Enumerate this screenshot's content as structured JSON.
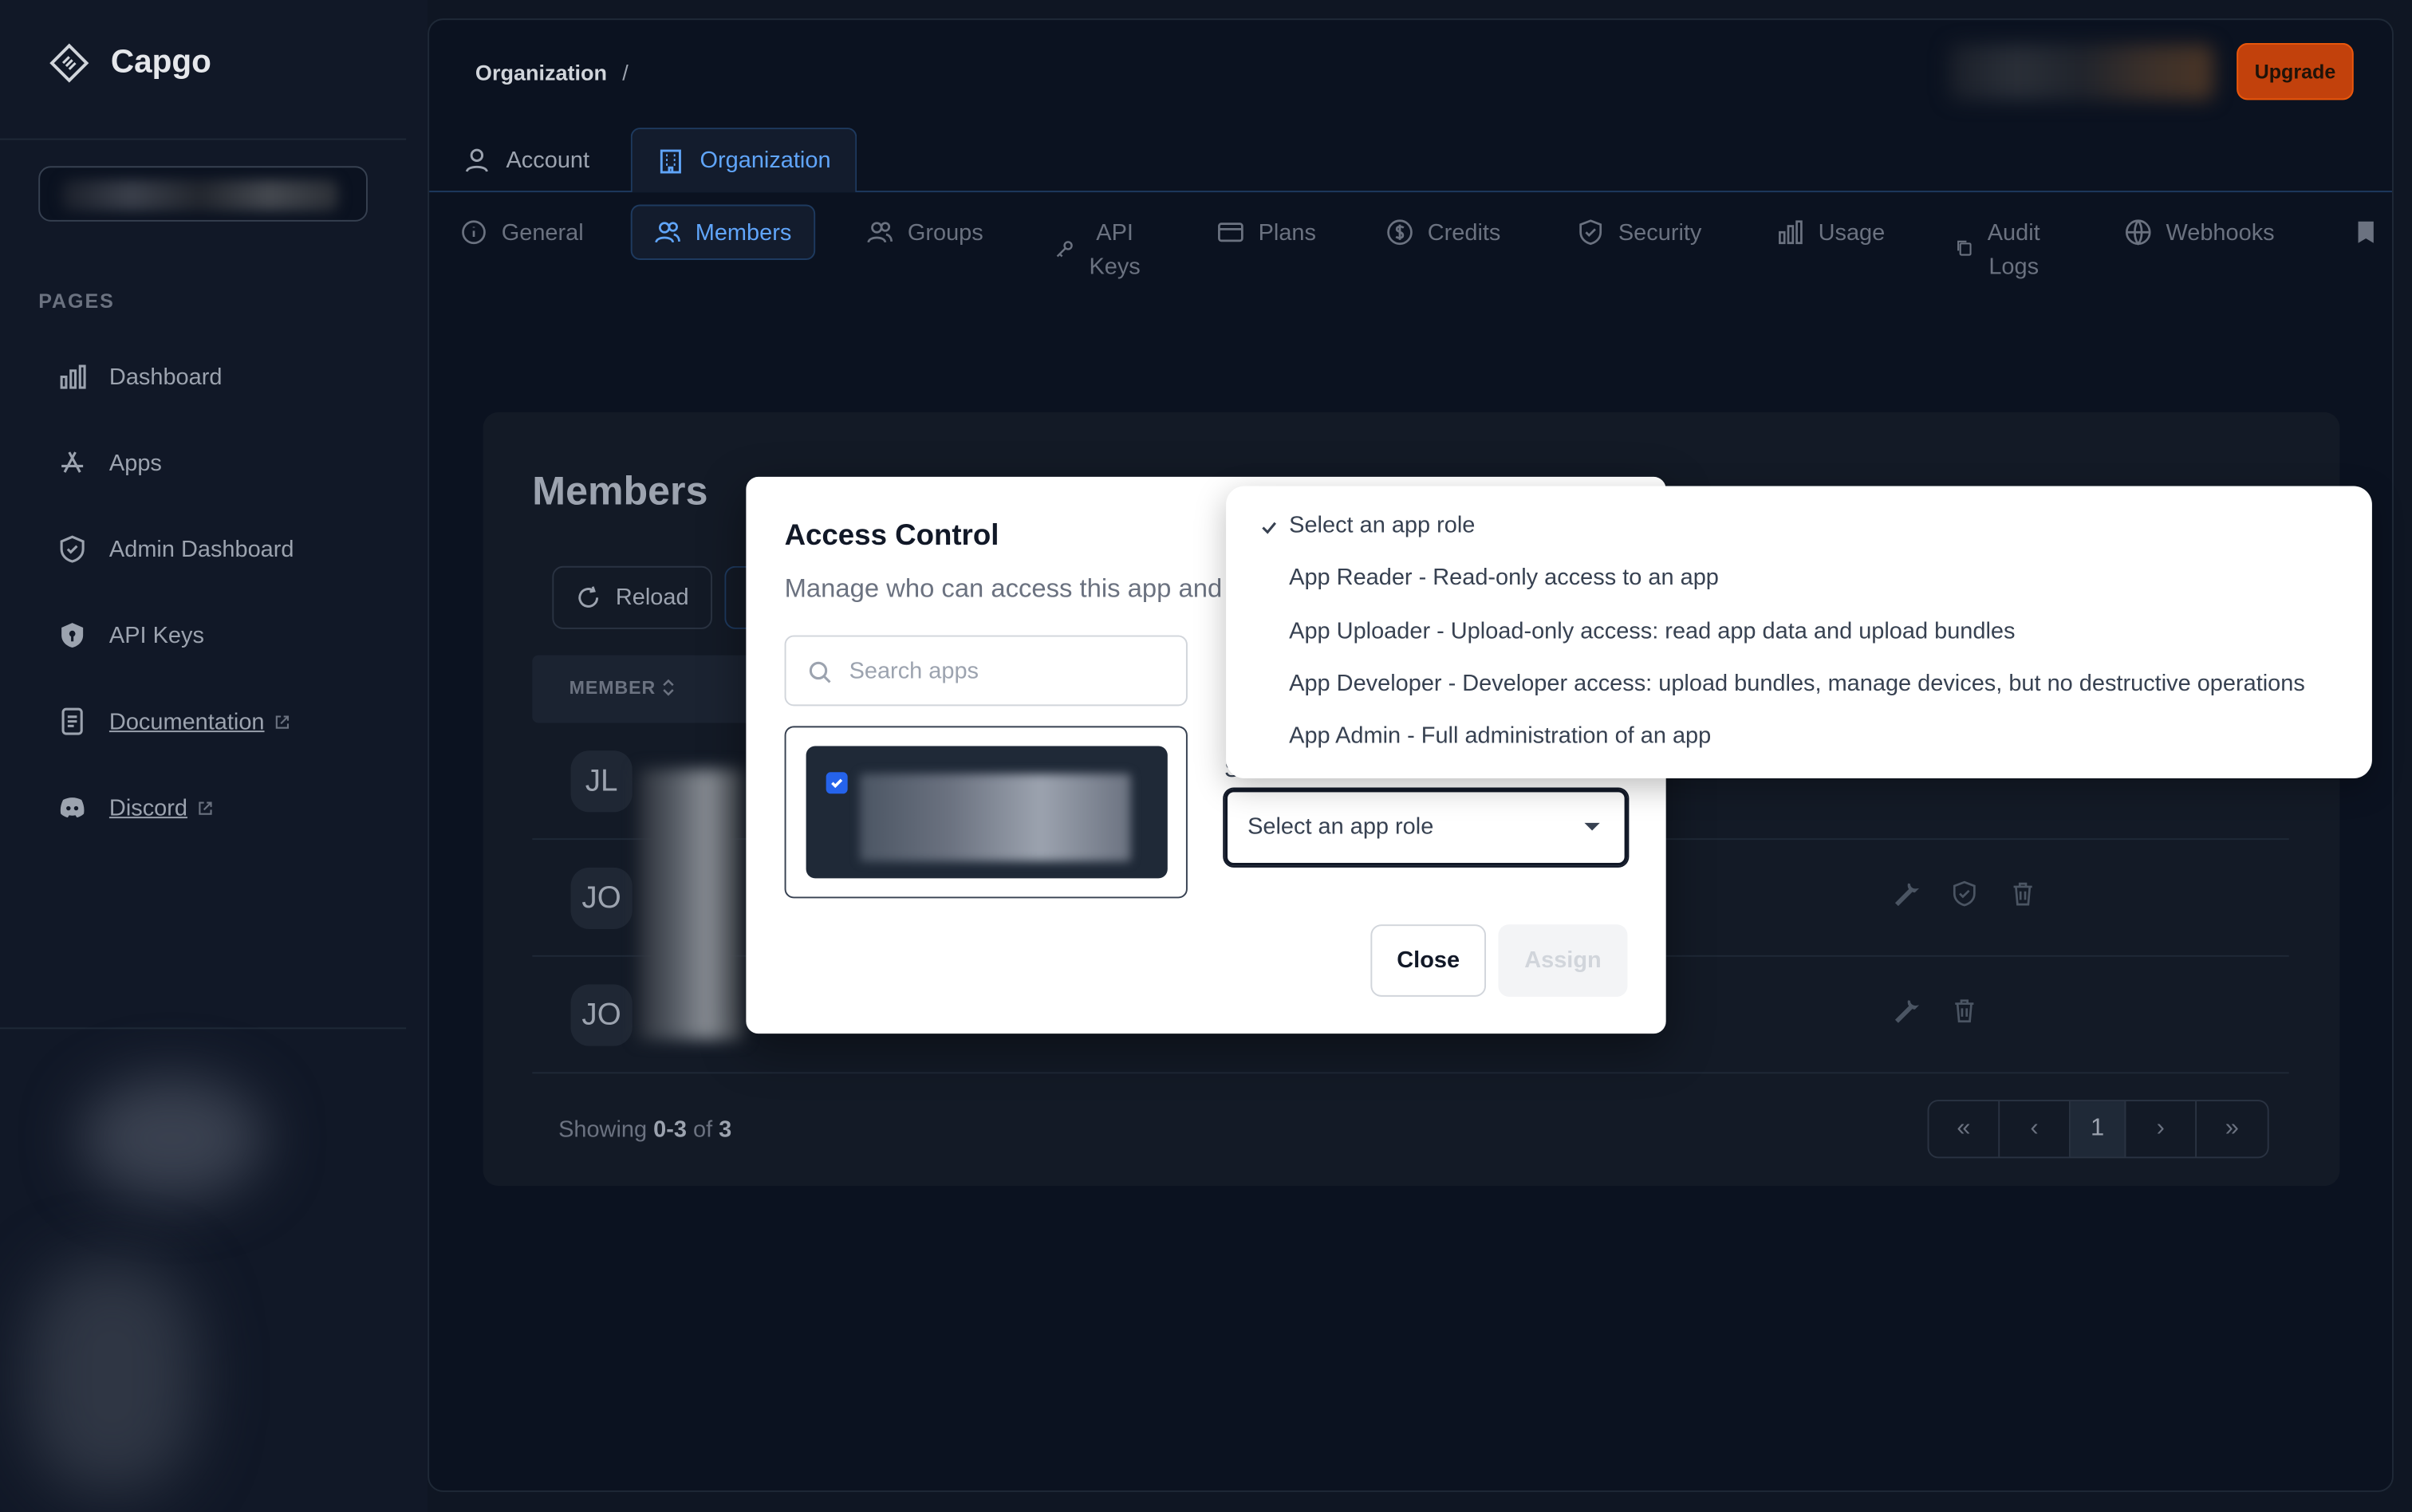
{
  "sidebar": {
    "brand": "Capgo",
    "section_label": "PAGES",
    "items": [
      {
        "label": "Dashboard",
        "icon": "bar-chart-icon"
      },
      {
        "label": "Apps",
        "icon": "app-store-icon"
      },
      {
        "label": "Admin Dashboard",
        "icon": "shield-icon"
      },
      {
        "label": "API Keys",
        "icon": "shield-key-icon"
      },
      {
        "label": "Documentation",
        "icon": "document-icon"
      },
      {
        "label": "Discord",
        "icon": "discord-icon"
      }
    ]
  },
  "header": {
    "breadcrumb": "Organization",
    "breadcrumb_sep": "/",
    "upgrade_label": "Upgrade"
  },
  "tabs_primary": [
    {
      "label": "Account",
      "active": false
    },
    {
      "label": "Organization",
      "active": true
    }
  ],
  "tabs_secondary": [
    {
      "label": "General"
    },
    {
      "label": "Members",
      "active": true
    },
    {
      "label": "Groups"
    },
    {
      "label_line1": "API",
      "label_line2": "Keys"
    },
    {
      "label": "Plans"
    },
    {
      "label": "Credits"
    },
    {
      "label": "Security"
    },
    {
      "label": "Usage"
    },
    {
      "label_line1": "Audit",
      "label_line2": "Logs"
    },
    {
      "label": "Webhooks"
    }
  ],
  "members": {
    "title": "Members",
    "reload_label": "Reload",
    "column_member": "MEMBER",
    "rows": [
      {
        "initials": "JL"
      },
      {
        "initials": "JO"
      },
      {
        "initials": "JO"
      }
    ],
    "showing_prefix": "Showing",
    "showing_range": "0-3",
    "showing_of": "of",
    "showing_total": "3",
    "pager": {
      "first": "«",
      "prev": "‹",
      "current": "1",
      "next": "›",
      "last": "»"
    }
  },
  "modal": {
    "title": "Access Control",
    "subtitle": "Manage who can access this app and",
    "search_placeholder": "Search apps",
    "role_label": "Select a role",
    "role_value": "Select an app role",
    "close_label": "Close",
    "assign_label": "Assign"
  },
  "role_dropdown": {
    "options": [
      "Select an app role",
      "App Reader - Read-only access to an app",
      "App Uploader - Upload-only access: read app data and upload bundles",
      "App Developer - Developer access: upload bundles, manage devices, but no destructive operations",
      "App Admin - Full administration of an app"
    ],
    "selected_index": 0
  },
  "colors": {
    "accent": "#60a5fa",
    "upgrade": "#c2410c",
    "background": "#0b1220"
  }
}
